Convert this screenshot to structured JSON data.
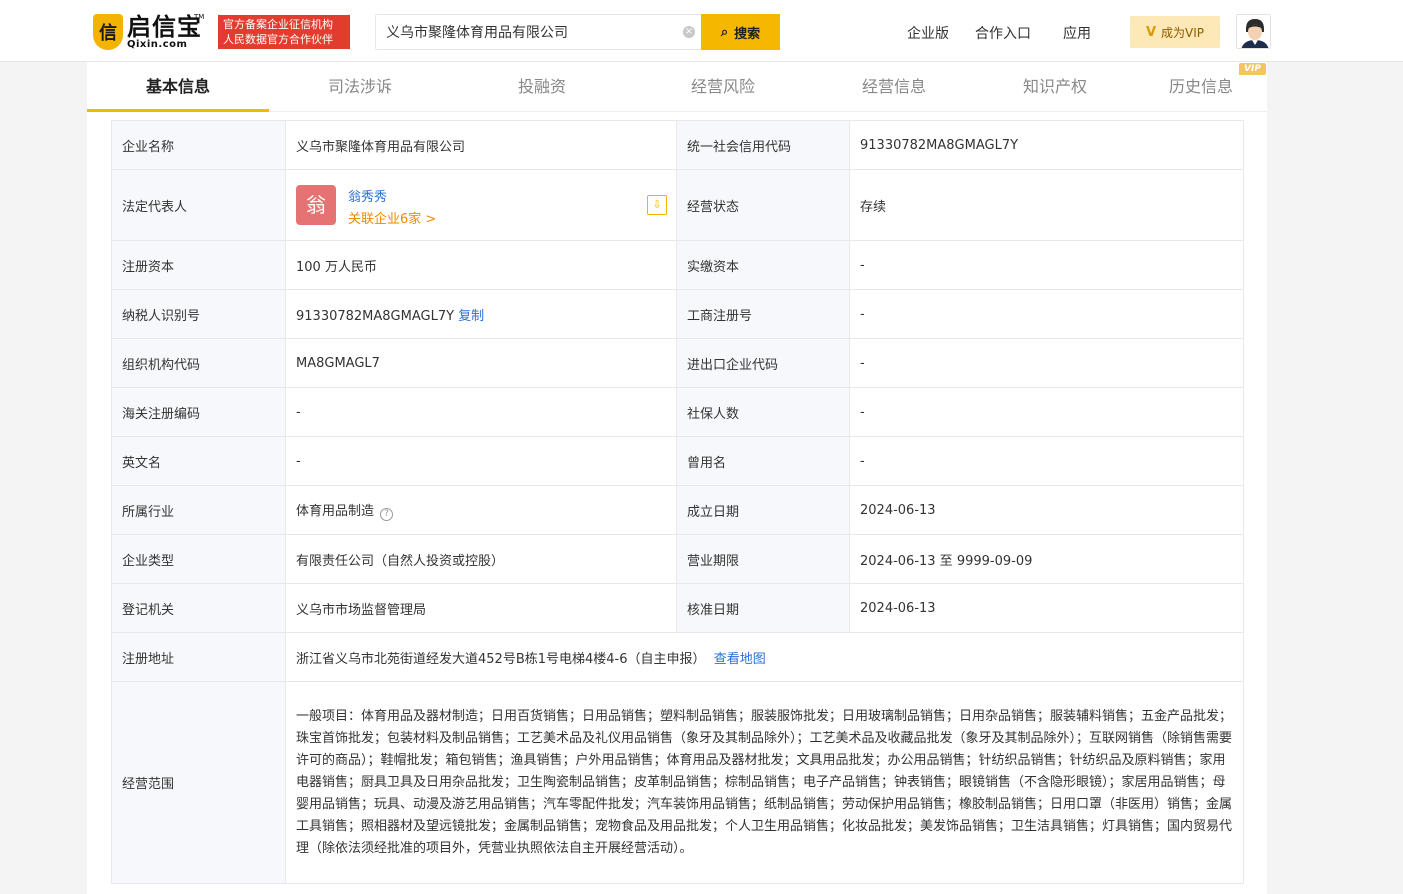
{
  "header": {
    "logo_cn": "启信宝",
    "logo_en": "Qixin.com",
    "logo_tm": "TM",
    "badge_line1": "官方备案企业征信机构",
    "badge_line2": "人民数据官方合作伙伴",
    "search_value": "义乌市聚隆体育用品有限公司",
    "search_button": "搜索",
    "nav": [
      "企业版",
      "合作入口",
      "应用"
    ],
    "vip_button": "成为VIP"
  },
  "tabs": [
    "基本信息",
    "司法涉诉",
    "投融资",
    "经营风险",
    "经营信息",
    "知识产权",
    "历史信息"
  ],
  "vip_tag": "VIP",
  "info": {
    "company_name_label": "企业名称",
    "company_name": "义乌市聚隆体育用品有限公司",
    "credit_code_label": "统一社会信用代码",
    "credit_code": "91330782MA8GMAGL7Y",
    "legal_rep_label": "法定代表人",
    "legal_rep_avatar": "翁",
    "legal_rep_name": "翁秀秀",
    "legal_rep_related": "关联企业6家 >",
    "status_label": "经营状态",
    "status": "存续",
    "reg_capital_label": "注册资本",
    "reg_capital": "100 万人民币",
    "paid_capital_label": "实缴资本",
    "paid_capital": "-",
    "tax_id_label": "纳税人识别号",
    "tax_id": "91330782MA8GMAGL7Y",
    "copy_label": "复制",
    "biz_reg_no_label": "工商注册号",
    "biz_reg_no": "-",
    "org_code_label": "组织机构代码",
    "org_code": "MA8GMAGL7",
    "import_export_label": "进出口企业代码",
    "import_export": "-",
    "customs_label": "海关注册编码",
    "customs": "-",
    "social_insurance_label": "社保人数",
    "social_insurance": "-",
    "english_name_label": "英文名",
    "english_name": "-",
    "former_name_label": "曾用名",
    "former_name": "-",
    "industry_label": "所属行业",
    "industry": "体育用品制造",
    "founded_label": "成立日期",
    "founded": "2024-06-13",
    "company_type_label": "企业类型",
    "company_type": "有限责任公司（自然人投资或控股）",
    "biz_term_label": "营业期限",
    "biz_term": "2024-06-13 至 9999-09-09",
    "reg_authority_label": "登记机关",
    "reg_authority": "义乌市市场监督管理局",
    "approval_date_label": "核准日期",
    "approval_date": "2024-06-13",
    "address_label": "注册地址",
    "address": "浙江省义乌市北苑街道经发大道452号B栋1号电梯4楼4-6（自主申报）",
    "view_map": "查看地图",
    "scope_label": "经营范围",
    "scope": "一般项目：体育用品及器材制造；日用百货销售；日用品销售；塑料制品销售；服装服饰批发；日用玻璃制品销售；日用杂品销售；服装辅料销售；五金产品批发；珠宝首饰批发；包装材料及制品销售；工艺美术品及礼仪用品销售（象牙及其制品除外）；工艺美术品及收藏品批发（象牙及其制品除外）；互联网销售（除销售需要许可的商品）；鞋帽批发；箱包销售；渔具销售；户外用品销售；体育用品及器材批发；文具用品批发；办公用品销售；针纺织品销售；针纺织品及原料销售；家用电器销售；厨具卫具及日用杂品批发；卫生陶瓷制品销售；皮革制品销售；棕制品销售；电子产品销售；钟表销售；眼镜销售（不含隐形眼镜）；家居用品销售；母婴用品销售；玩具、动漫及游艺用品销售；汽车零配件批发；汽车装饰用品销售；纸制品销售；劳动保护用品销售；橡胶制品销售；日用口罩（非医用）销售；金属工具销售；照相器材及望远镜批发；金属制品销售；宠物食品及用品批发；个人卫生用品销售；化妆品批发；美发饰品销售；卫生洁具销售；灯具销售；国内贸易代理（除依法须经批准的项目外，凭营业执照依法自主开展经营活动）。"
  }
}
